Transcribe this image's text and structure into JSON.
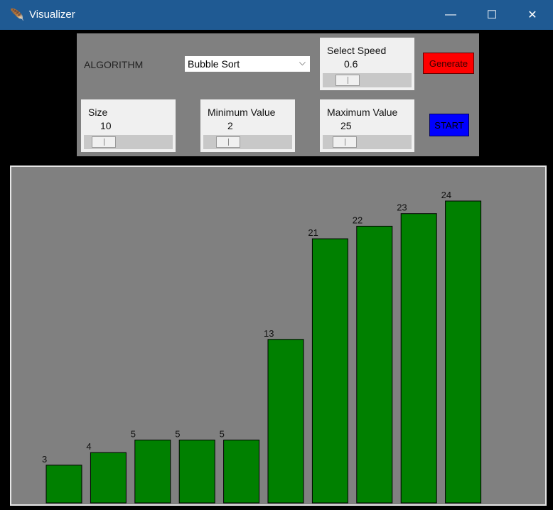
{
  "window": {
    "title": "Visualizer",
    "icon": "feather-icon",
    "minimize_glyph": "—",
    "maximize_glyph": "☐",
    "close_glyph": "✕"
  },
  "controls": {
    "algorithm_label": "ALGORITHM",
    "algorithm_selected": "Bubble Sort",
    "speed": {
      "label": "Select Speed",
      "value": "0.6"
    },
    "size": {
      "label": "Size",
      "value": "10"
    },
    "min_value": {
      "label": "Minimum Value",
      "value": "2"
    },
    "max_value": {
      "label": "Maximum Value",
      "value": "25"
    },
    "generate_label": "Generate",
    "start_label": "START"
  },
  "colors": {
    "bar": "#008000",
    "canvas": "#808080",
    "generate": "#ff0000",
    "start": "#0000ff",
    "titlebar": "#1f5a93"
  },
  "chart_data": {
    "type": "bar",
    "values": [
      3,
      4,
      5,
      5,
      5,
      13,
      21,
      22,
      23,
      24
    ],
    "labels": [
      "3",
      "4",
      "5",
      "5",
      "5",
      "13",
      "21",
      "22",
      "23",
      "24"
    ]
  }
}
